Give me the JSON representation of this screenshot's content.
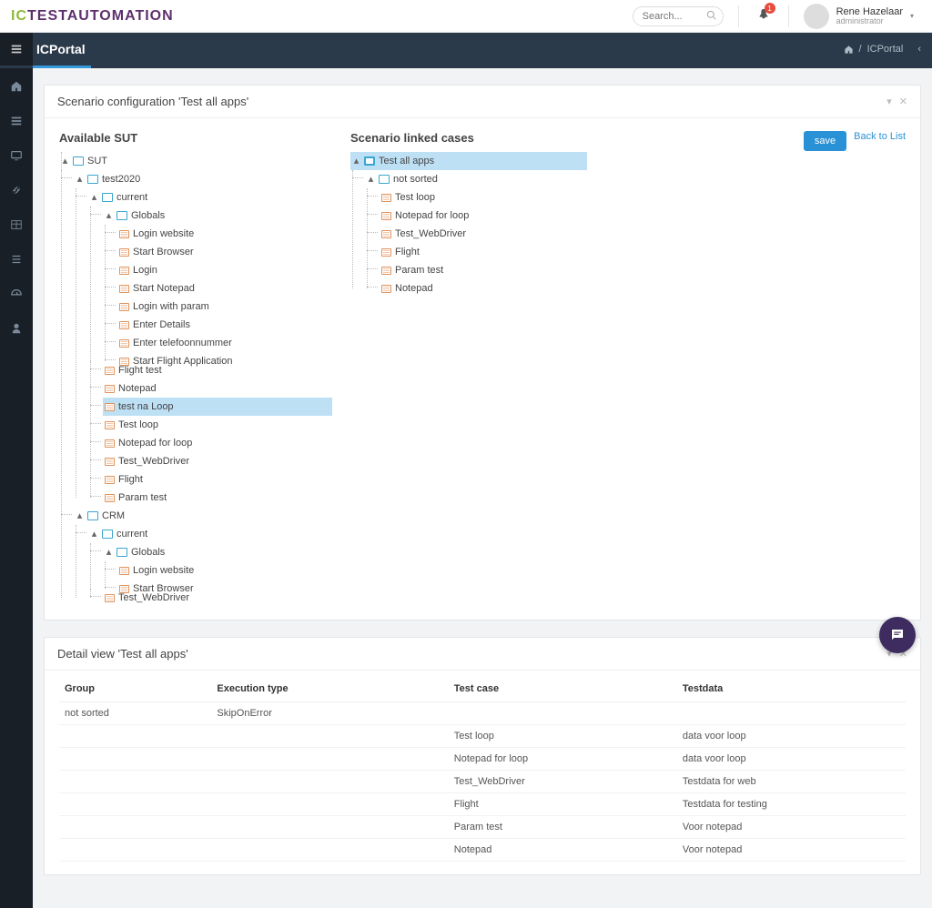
{
  "topbar": {
    "logo_prefix": "IC",
    "logo_rest": "TESTAUTOMATION",
    "search_placeholder": "Search...",
    "notification_count": "1",
    "user_name": "Rene Hazelaar",
    "user_role": "administrator"
  },
  "header": {
    "title": "ICPortal",
    "breadcrumb": "ICPortal"
  },
  "panel1": {
    "title": "Scenario configuration 'Test all apps'"
  },
  "tree1": {
    "title": "Available SUT",
    "root": "SUT",
    "n_test2020": "test2020",
    "n_current": "current",
    "n_globals": "Globals",
    "leaves_globals": [
      "Login website",
      "Start Browser",
      "Login",
      "Start Notepad",
      "Login with param",
      "Enter Details",
      "Enter telefoonnummer",
      "Start Flight Application"
    ],
    "leaves_current": [
      "Flight test",
      "Notepad",
      "test na Loop",
      "Test loop",
      "Notepad for loop",
      "Test_WebDriver",
      "Flight",
      "Param test"
    ],
    "n_crm": "CRM",
    "n_crm_current": "current",
    "n_crm_globals": "Globals",
    "leaves_crm_globals": [
      "Login website",
      "Start Browser"
    ],
    "leaves_crm": [
      "Test_WebDriver"
    ]
  },
  "tree2": {
    "title": "Scenario linked cases",
    "root": "Test all apps",
    "n_notsorted": "not sorted",
    "leaves": [
      "Test loop",
      "Notepad for loop",
      "Test_WebDriver",
      "Flight",
      "Param test",
      "Notepad"
    ]
  },
  "actions": {
    "save": "save",
    "back": "Back to List"
  },
  "panel2": {
    "title": "Detail view 'Test all apps'"
  },
  "table": {
    "headers": {
      "group": "Group",
      "exec": "Execution type",
      "testcase": "Test case",
      "testdata": "Testdata"
    },
    "rows": [
      {
        "group": "not sorted",
        "exec": "SkipOnError",
        "testcase": "",
        "testdata": ""
      },
      {
        "group": "",
        "exec": "",
        "testcase": "Test loop",
        "testdata": "data voor loop"
      },
      {
        "group": "",
        "exec": "",
        "testcase": "Notepad for loop",
        "testdata": "data voor loop"
      },
      {
        "group": "",
        "exec": "",
        "testcase": "Test_WebDriver",
        "testdata": "Testdata for web"
      },
      {
        "group": "",
        "exec": "",
        "testcase": "Flight",
        "testdata": "Testdata for testing"
      },
      {
        "group": "",
        "exec": "",
        "testcase": "Param test",
        "testdata": "Voor notepad"
      },
      {
        "group": "",
        "exec": "",
        "testcase": "Notepad",
        "testdata": "Voor notepad"
      }
    ]
  }
}
